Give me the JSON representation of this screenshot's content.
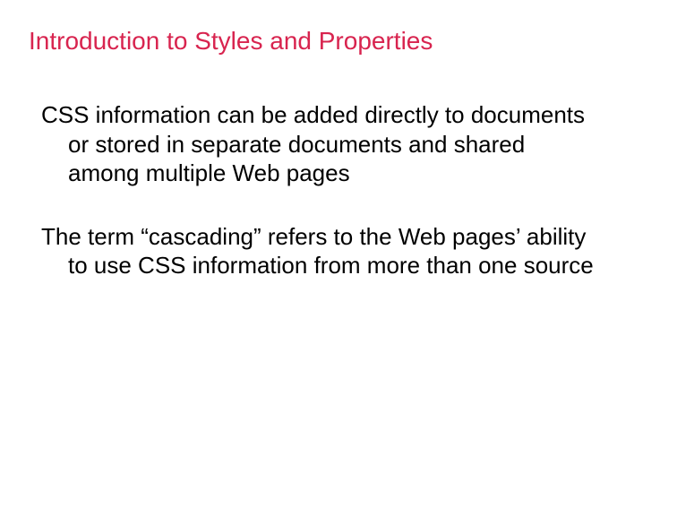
{
  "slide": {
    "title": "Introduction to Styles and Properties",
    "paragraphs": [
      "CSS information can be added directly to documents or stored in separate documents and shared among multiple Web pages",
      "The term “cascading” refers to the Web pages’ ability to use CSS information from more than one source"
    ]
  }
}
